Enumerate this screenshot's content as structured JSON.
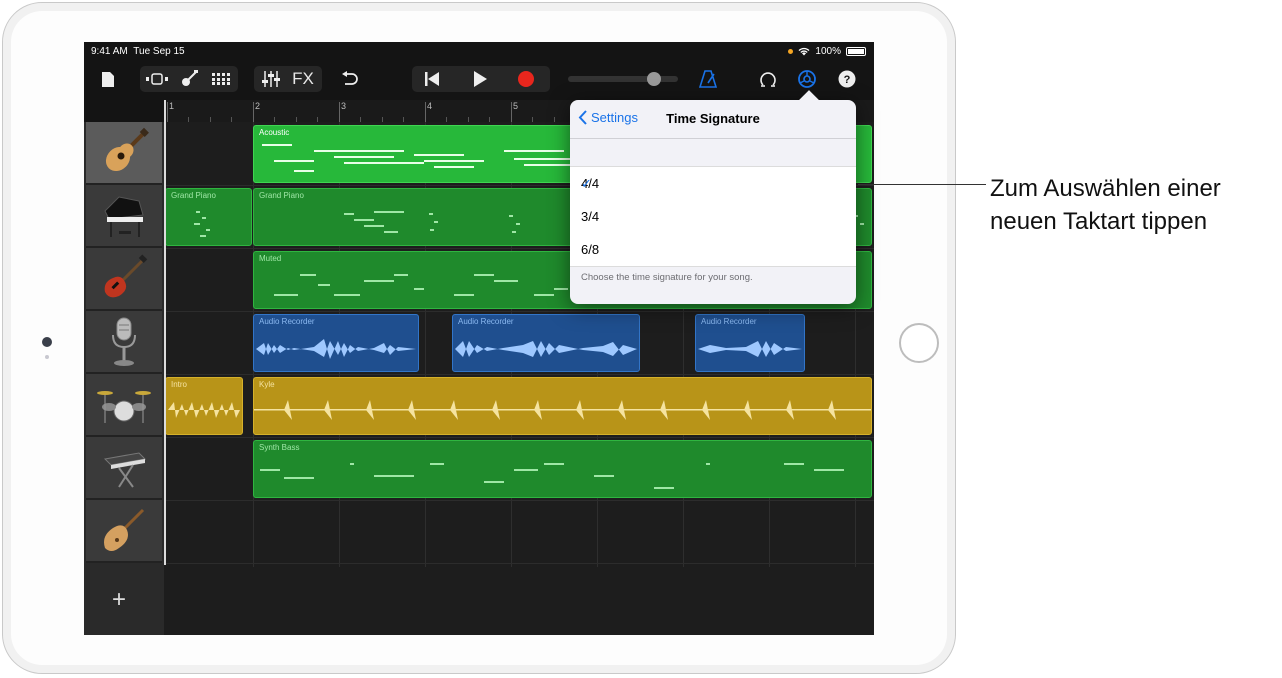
{
  "status": {
    "time": "9:41 AM",
    "date": "Tue Sep 15",
    "battery": "100%"
  },
  "toolbar": {
    "fx_label": "FX",
    "icons": [
      "my-songs-icon",
      "views-icon",
      "instrument-icon",
      "grid-icon",
      "mixer-icon",
      "undo-icon",
      "rewind-icon",
      "play-icon",
      "record-icon",
      "metronome-icon",
      "loop-icon",
      "settings-icon",
      "help-icon"
    ]
  },
  "ruler": {
    "bars": [
      "1",
      "2",
      "3",
      "4",
      "5"
    ]
  },
  "tracks": [
    {
      "instrument": "acoustic-guitar-icon",
      "regions": [
        "Acoustic"
      ]
    },
    {
      "instrument": "grand-piano-icon",
      "regions": [
        "Grand Piano",
        "Grand Piano"
      ]
    },
    {
      "instrument": "bass-guitar-icon",
      "regions": [
        "Muted"
      ]
    },
    {
      "instrument": "microphone-icon",
      "regions": [
        "Audio Recorder",
        "Audio Recorder",
        "Audio Recorder"
      ]
    },
    {
      "instrument": "drum-kit-icon",
      "regions": [
        "Intro",
        "Kyle"
      ]
    },
    {
      "instrument": "synth-keyboard-icon",
      "regions": [
        "Synth Bass"
      ]
    },
    {
      "instrument": "pipa-icon",
      "regions": []
    }
  ],
  "add_track": "+",
  "popover": {
    "back_label": "Settings",
    "title": "Time Signature",
    "options": [
      "4/4",
      "3/4",
      "6/8"
    ],
    "selected": "4/4",
    "footer": "Choose the time signature for your song."
  },
  "callout": {
    "line1": "Zum Auswählen einer",
    "line2": "neuen Taktart tippen"
  },
  "colors": {
    "accent": "#1a73e8",
    "region_green": "#1f8a2c",
    "region_bright_green": "#27b83a",
    "region_blue": "#1f4f8f",
    "region_yellow": "#b89418",
    "record": "#e8261d"
  }
}
